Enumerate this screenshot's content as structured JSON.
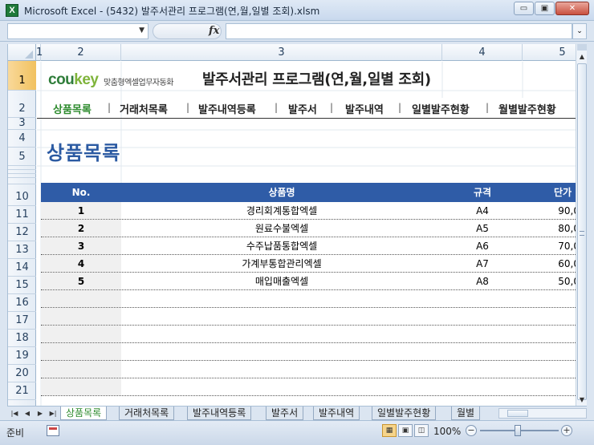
{
  "window": {
    "title": "Microsoft Excel - (5432) 발주서관리 프로그램(연,월,일별 조회).xlsm",
    "app_icon_letter": "X",
    "minimize_label": "▭",
    "restore_label": "▣",
    "close_label": "✕"
  },
  "formula_bar": {
    "name_box": "",
    "fx_label": "fx",
    "formula": ""
  },
  "columns": [
    "1",
    "2",
    "3",
    "4",
    "5"
  ],
  "rows": [
    "1",
    "2",
    "3",
    "4",
    "5",
    "10",
    "11",
    "12",
    "13",
    "14",
    "15",
    "16",
    "17",
    "18",
    "19",
    "20",
    "21"
  ],
  "header": {
    "logo_main": "cou",
    "logo_accent": "key",
    "logo_sub": "맞춤형엑셀업무자동화",
    "title": "발주서관리 프로그램(연,월,일별 조회)"
  },
  "menu": [
    {
      "label": "상품목록",
      "active": true
    },
    {
      "label": "거래처목록",
      "active": false
    },
    {
      "label": "발주내역등록",
      "active": false
    },
    {
      "label": "발주서",
      "active": false
    },
    {
      "label": "발주내역",
      "active": false
    },
    {
      "label": "일별발주현황",
      "active": false
    },
    {
      "label": "월별발주현황",
      "active": false
    }
  ],
  "menu_separator": "|",
  "section_title": "상품목록",
  "table": {
    "headers": {
      "no": "No.",
      "name": "상품명",
      "spec": "규격",
      "price": "단가"
    },
    "rows": [
      {
        "no": "1",
        "name": "경리회계통합엑셀",
        "spec": "A4",
        "price": "90,0"
      },
      {
        "no": "2",
        "name": "원료수불엑셀",
        "spec": "A5",
        "price": "80,0"
      },
      {
        "no": "3",
        "name": "수주납품통합엑셀",
        "spec": "A6",
        "price": "70,0"
      },
      {
        "no": "4",
        "name": "가계부통합관리엑셀",
        "spec": "A7",
        "price": "60,0"
      },
      {
        "no": "5",
        "name": "매입매출엑셀",
        "spec": "A8",
        "price": "50,0"
      }
    ]
  },
  "sheet_tabs": [
    {
      "label": "상품목록",
      "active": true
    },
    {
      "label": "거래처목록",
      "active": false
    },
    {
      "label": "발주내역등록",
      "active": false
    },
    {
      "label": "발주서",
      "active": false
    },
    {
      "label": "발주내역",
      "active": false
    },
    {
      "label": "일별발주현황",
      "active": false
    },
    {
      "label": "월별",
      "active": false
    }
  ],
  "tab_nav": [
    "|◀",
    "◀",
    "▶",
    "▶|"
  ],
  "status": {
    "ready": "준비",
    "zoom": "100%",
    "zoom_minus": "−",
    "zoom_plus": "+"
  }
}
